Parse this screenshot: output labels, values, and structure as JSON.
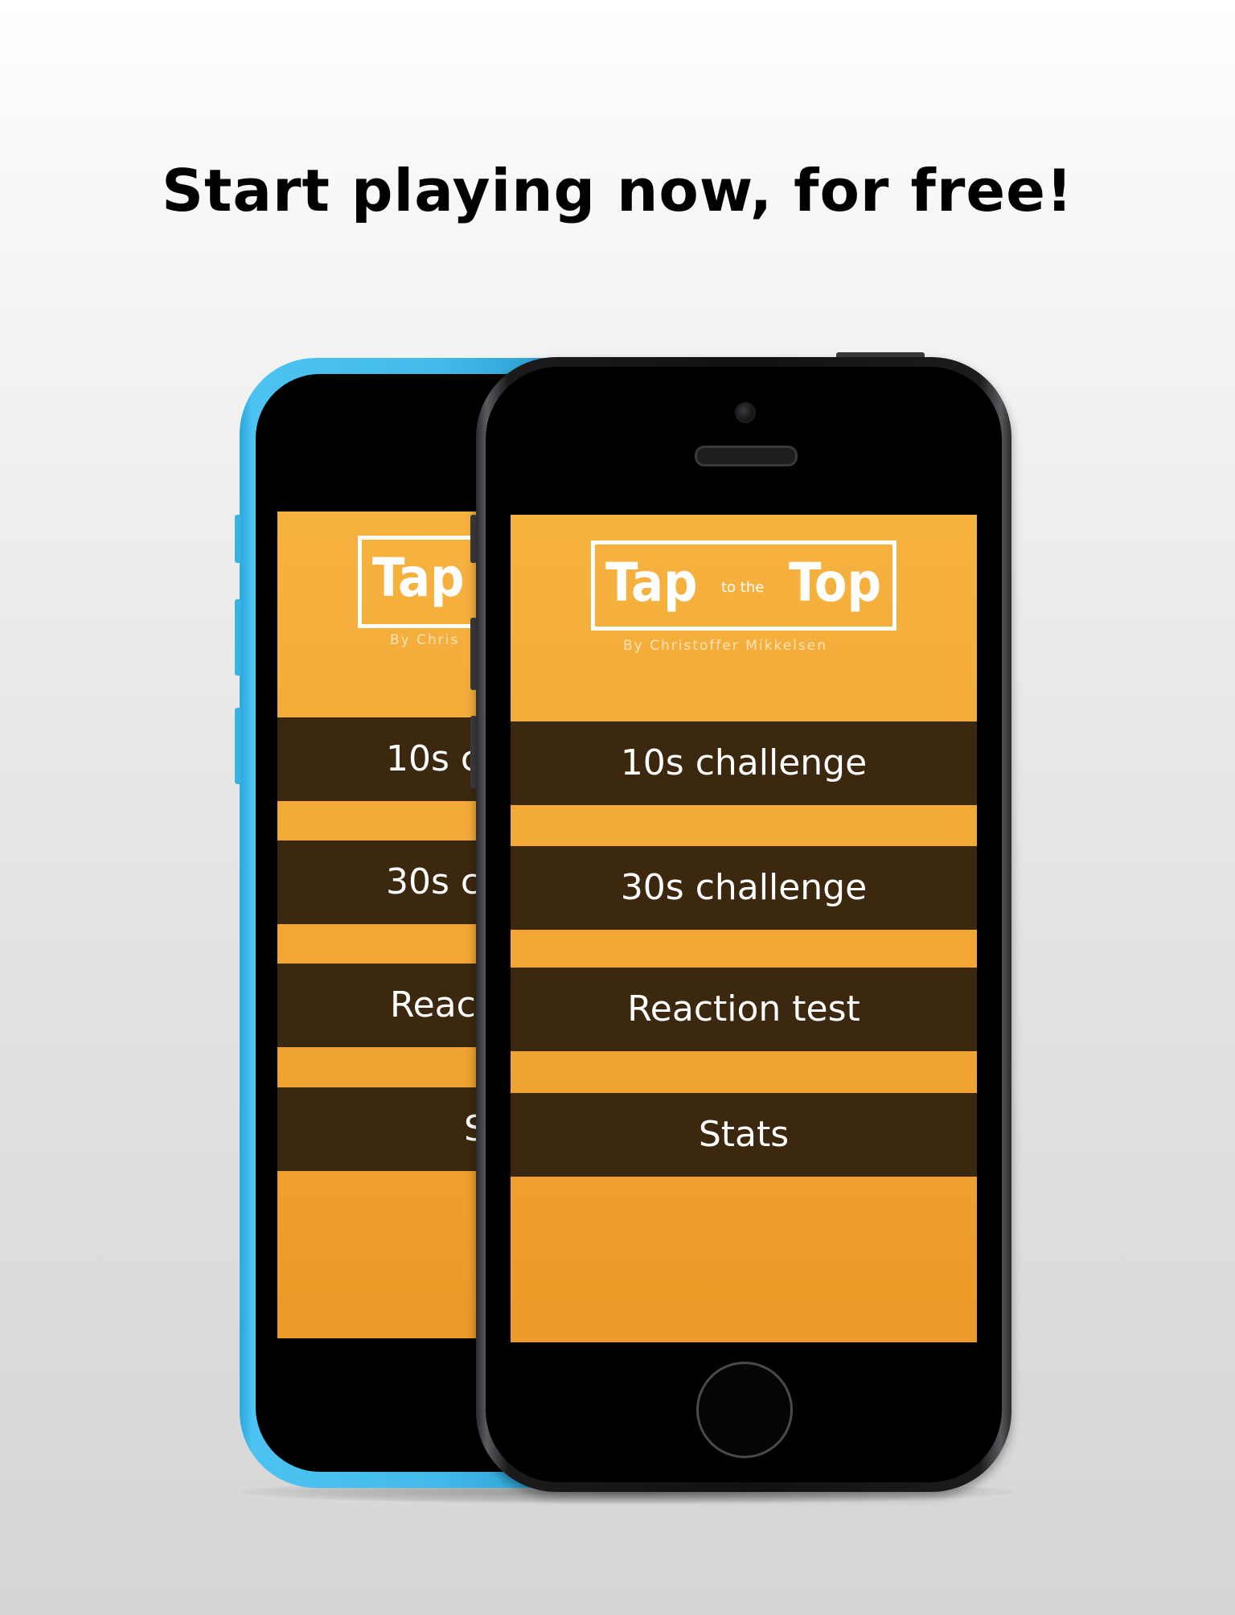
{
  "headline": "Start playing now, for free!",
  "app": {
    "logo_word_1": "Tap",
    "logo_connector": "to the",
    "logo_word_2": "Top",
    "byline": "By Christoffer Mikkelsen"
  },
  "front_menu": [
    {
      "label": "10s challenge"
    },
    {
      "label": "30s challenge"
    },
    {
      "label": "Reaction test"
    },
    {
      "label": "Stats"
    }
  ],
  "back_screen": {
    "logo_word": "Tap",
    "byline": "By Chris",
    "menu": [
      {
        "label": "10s c"
      },
      {
        "label": "30s c"
      },
      {
        "label": "Reac"
      },
      {
        "label": "S"
      }
    ]
  },
  "colors": {
    "screen_orange": "#f2a633",
    "menu_bar_brown": "#3c280e",
    "back_phone_blue": "#43bbea",
    "front_phone_black": "#111112"
  },
  "icons": [
    "front-camera-icon",
    "speaker-grille-icon",
    "home-button-icon"
  ]
}
